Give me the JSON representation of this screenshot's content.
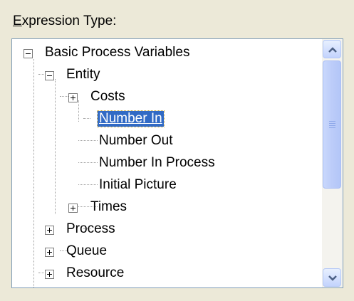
{
  "group_label": {
    "first": "E",
    "rest": "xpression Type:"
  },
  "tree": {
    "rows": [
      {
        "label": "Basic Process Variables",
        "expander": "minus"
      },
      {
        "label": "Entity",
        "expander": "minus"
      },
      {
        "label": "Costs",
        "expander": "plus"
      },
      {
        "label": "Number In",
        "expander": "none",
        "selected": true
      },
      {
        "label": "Number Out",
        "expander": "none"
      },
      {
        "label": "Number In Process",
        "expander": "none"
      },
      {
        "label": "Initial Picture",
        "expander": "none"
      },
      {
        "label": "Times",
        "expander": "plus"
      },
      {
        "label": "Process",
        "expander": "plus"
      },
      {
        "label": "Queue",
        "expander": "plus"
      },
      {
        "label": "Resource",
        "expander": "plus"
      }
    ]
  },
  "scrollbar": {
    "up_icon": "chevron-up-icon",
    "down_icon": "chevron-down-icon"
  },
  "colors": {
    "selection": "#316AC5",
    "window_bg": "#ECE9D8",
    "border": "#7F9DB9"
  }
}
